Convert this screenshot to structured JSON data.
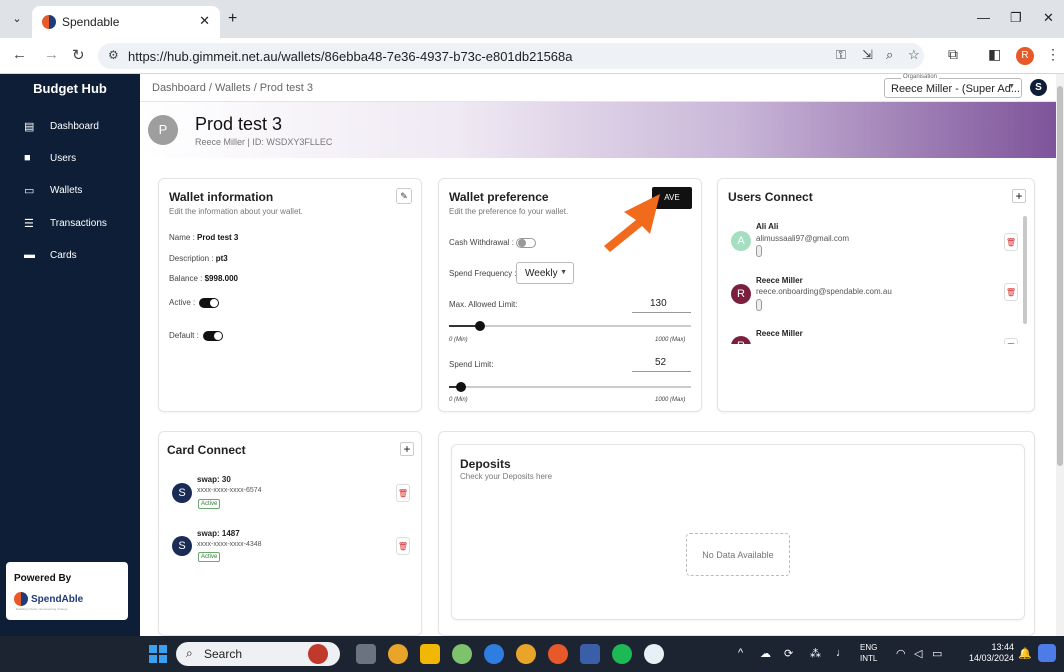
{
  "browser": {
    "tab_title": "Spendable",
    "url": "https://hub.gimmeit.net.au/wallets/86ebba48-7e36-4937-b73c-e801db21568a",
    "profile_initial": "R"
  },
  "sidebar": {
    "brand": "Budget Hub",
    "items": [
      {
        "label": "Dashboard"
      },
      {
        "label": "Users"
      },
      {
        "label": "Wallets"
      },
      {
        "label": "Transactions"
      },
      {
        "label": "Cards"
      }
    ],
    "powered_by": "Powered By",
    "logo_text": "SpendAble",
    "tagline": "Enabling Choice, Empowering Change"
  },
  "header": {
    "breadcrumb": "Dashboard / Wallets / Prod test 3",
    "org_label": "Organisation",
    "org_value": "Reece Miller - (Super Ad...",
    "user_initial": "S"
  },
  "banner": {
    "avatar": "P",
    "title": "Prod test 3",
    "subtitle": "Reece Miller | ID: WSDXY3FLLEC"
  },
  "wallet_info": {
    "title": "Wallet information",
    "subtitle": "Edit the information about your wallet.",
    "name_label": "Name :",
    "name_value": "Prod test 3",
    "desc_label": "Description :",
    "desc_value": "pt3",
    "balance_label": "Balance :",
    "balance_value": "$998.000",
    "active_label": "Active :",
    "default_label": "Default :"
  },
  "wallet_pref": {
    "title": "Wallet preference",
    "subtitle": "Edit the preference fo your wallet.",
    "save_label": "AVE",
    "cash_label": "Cash Withdrawal :",
    "freq_label": "Spend Frequency :",
    "freq_value": "Weekly",
    "max_label": "Max. Allowed Limit:",
    "max_value": "130",
    "spend_label": "Spend Limit:",
    "spend_value": "52",
    "min_caption": "0 (Min)",
    "max_caption": "1000 (Max)"
  },
  "users_connect": {
    "title": "Users Connect",
    "users": [
      {
        "initial": "A",
        "name": "Ali Ali",
        "email": "alimussaali97@gmail.com"
      },
      {
        "initial": "R",
        "name": "Reece Miller",
        "email": "reece.onboarding@spendable.com.au"
      },
      {
        "initial": "R",
        "name": "Reece Miller",
        "email": ""
      }
    ]
  },
  "card_connect": {
    "title": "Card Connect",
    "cards": [
      {
        "initial": "S",
        "name": "swap: 30",
        "number": "xxxx-xxxx-xxxx-6574",
        "status": "Active"
      },
      {
        "initial": "S",
        "name": "swap: 1487",
        "number": "xxxx-xxxx-xxxx-4348",
        "status": "Active"
      }
    ]
  },
  "deposits": {
    "title": "Deposits",
    "subtitle": "Check your Deposits here",
    "empty": "No Data Available"
  },
  "taskbar": {
    "search": "Search",
    "lang_1": "ENG",
    "lang_2": "INTL",
    "time": "13:44",
    "date": "14/03/2024"
  },
  "colors": {
    "sidebar": "#0f1e37",
    "accent_arrow": "#f26a1b",
    "danger": "#d62b2b"
  }
}
